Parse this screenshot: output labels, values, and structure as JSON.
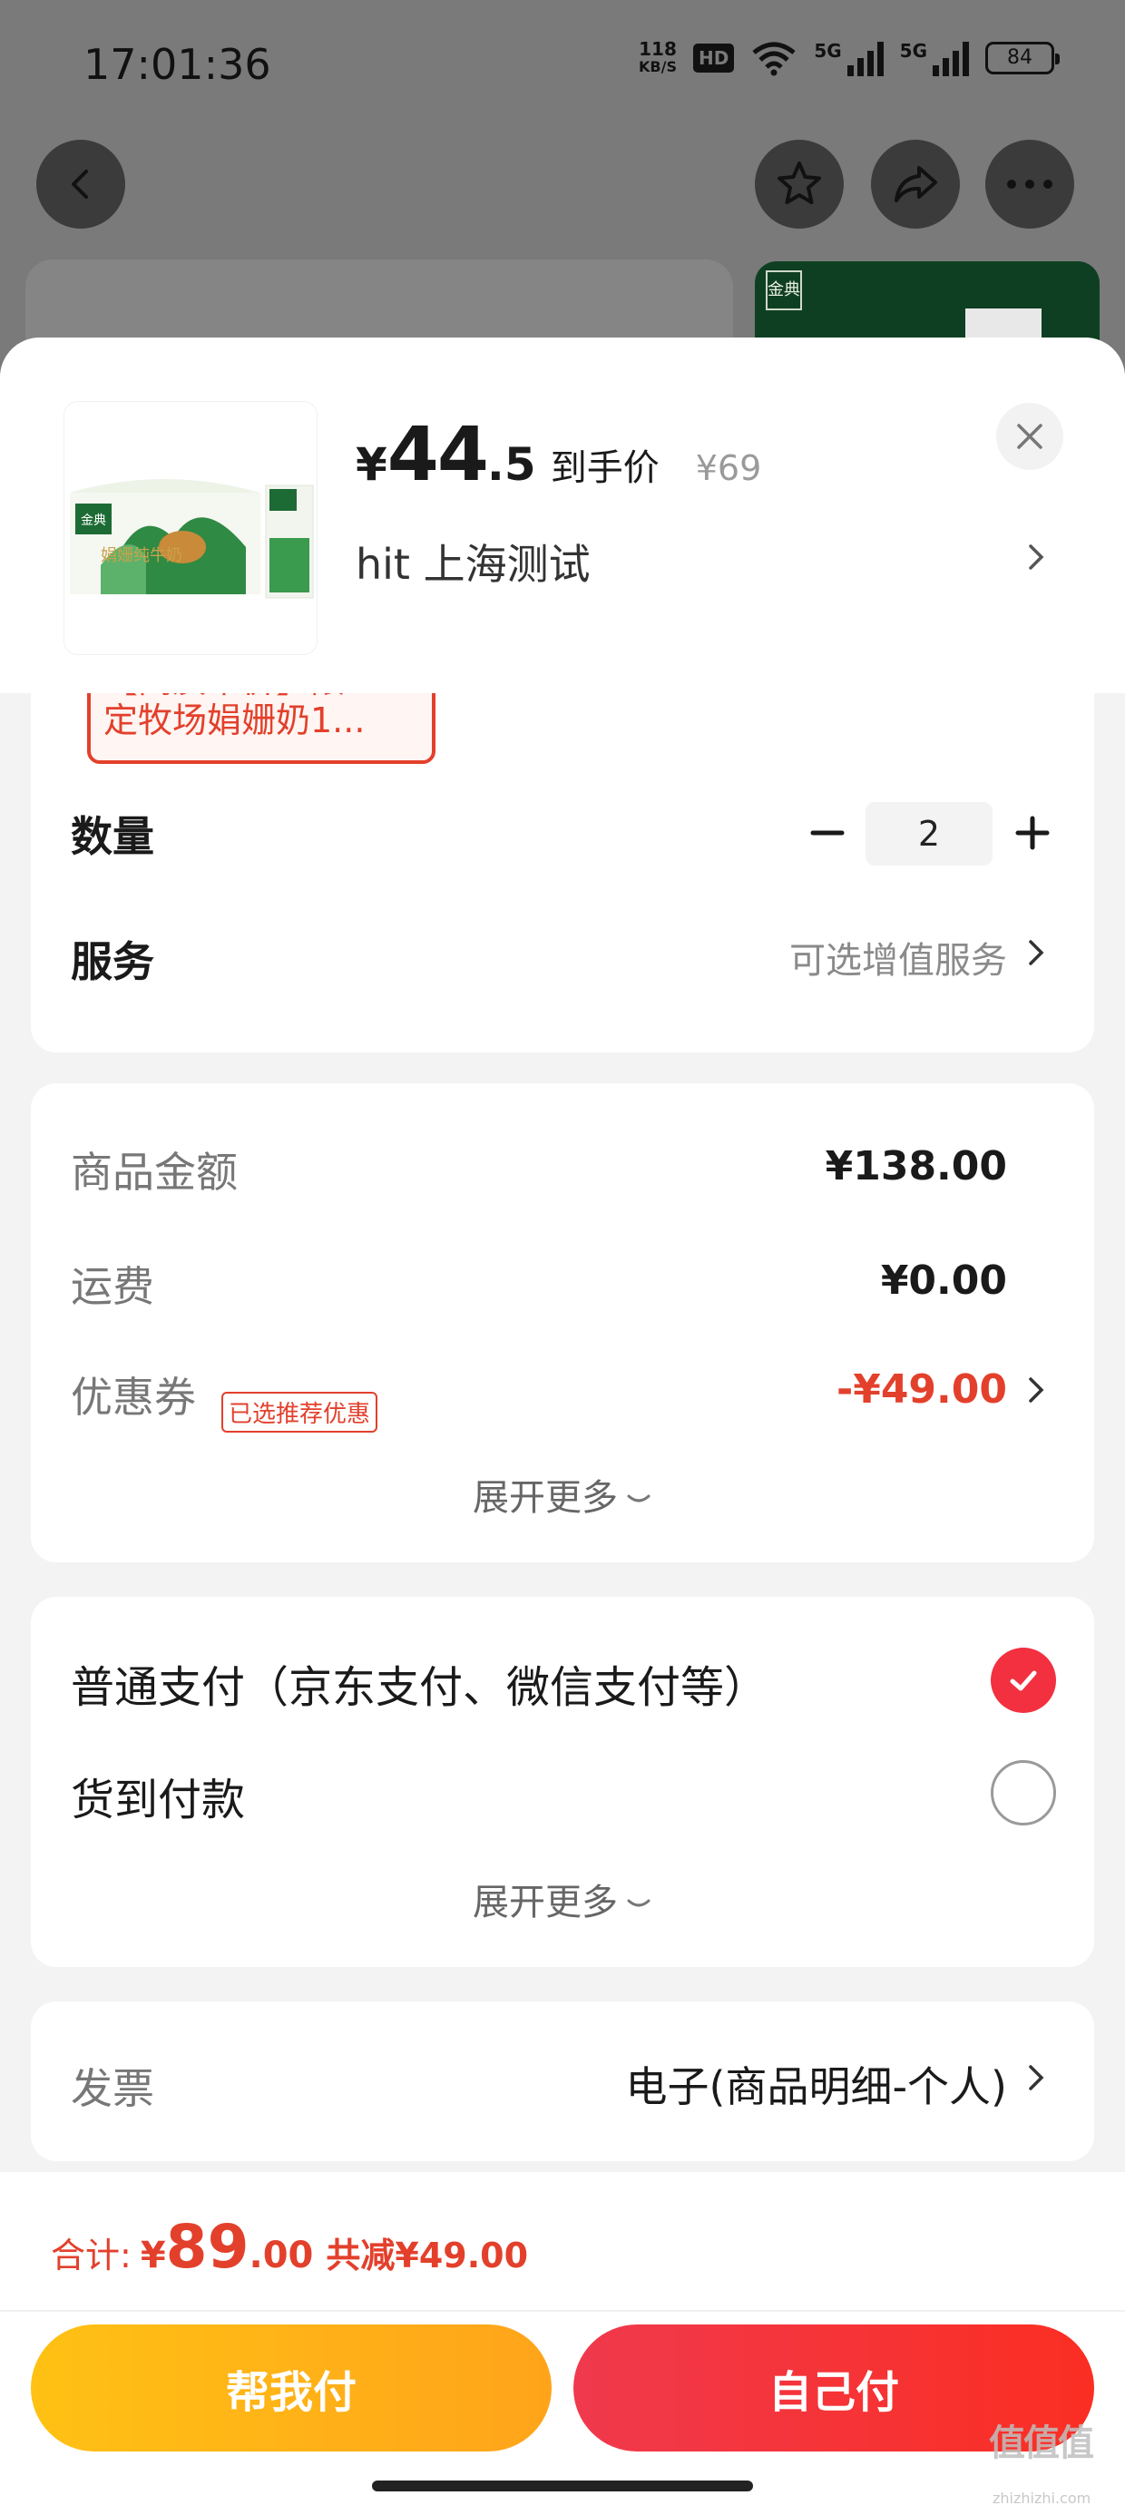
{
  "status_bar": {
    "time": "17:01:36",
    "net_speed_value": "118",
    "net_speed_unit": "KB/S",
    "hd_label": "HD",
    "sim1_label": "5G",
    "sim2_label": "5G",
    "battery": "84"
  },
  "product": {
    "price_symbol": "¥",
    "price_int": "44",
    "price_dec": ".5",
    "price_label": "到手价",
    "original_price": "¥69",
    "image_brand": "金典",
    "address": "hit  上海测试"
  },
  "promo_tag": {
    "line1": "【高质平价】限",
    "line2": "定牧场娟姗奶1..."
  },
  "quantity": {
    "label": "数量",
    "value": "2"
  },
  "service": {
    "label": "服务",
    "value": "可选增值服务"
  },
  "summary": {
    "goods_label": "商品金额",
    "goods_value": "¥138.00",
    "shipping_label": "运费",
    "shipping_value": "¥0.00",
    "coupon_label": "优惠券",
    "coupon_tag": "已选推荐优惠",
    "coupon_value": "-¥49.00",
    "expand_label": "展开更多"
  },
  "payment": {
    "option1": "普通支付（京东支付、微信支付等）",
    "option2": "货到付款",
    "selected": 0,
    "expand_label": "展开更多"
  },
  "invoice": {
    "label": "发票",
    "value": "电子(商品明细-个人)"
  },
  "footer": {
    "total_label": "合计:",
    "total_symbol": "¥",
    "total_int": "89",
    "total_dec": ".00",
    "total_saving": "共减¥49.00",
    "help_pay_label": "帮我付",
    "self_pay_label": "自己付"
  },
  "watermark": {
    "text": "值值值",
    "site": "zhizhizhi.com"
  },
  "colors": {
    "accent_red": "#e3402c",
    "radio_red": "#f2303f",
    "help_btn_yellow": "#ffb31a",
    "self_btn_red": "#f5334a"
  }
}
